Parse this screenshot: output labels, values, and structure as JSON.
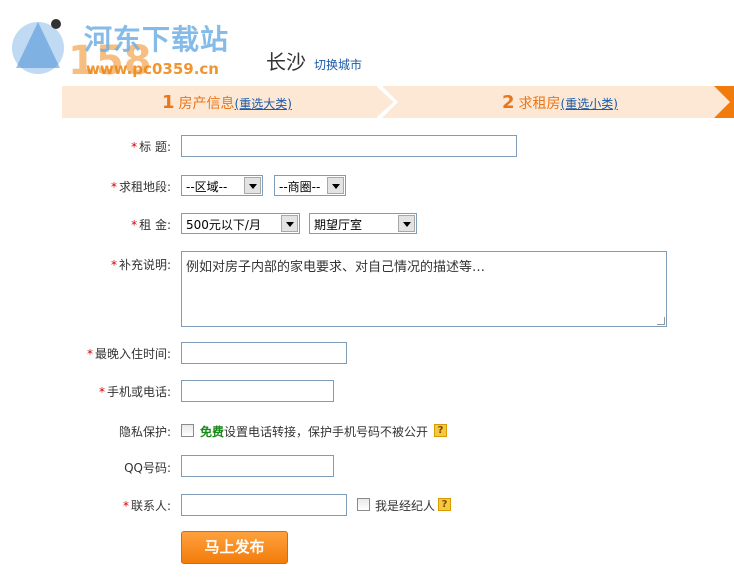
{
  "header": {
    "logo_text": "河东下载站",
    "logo_number": "158",
    "logo_url": "www.pc0359.cn",
    "city": "长沙",
    "switch_city": "切换城市"
  },
  "steps": [
    {
      "num": "1",
      "label": "房产信息",
      "sub": "(重选大类)"
    },
    {
      "num": "2",
      "label": "求租房",
      "sub": "(重选小类)"
    }
  ],
  "form": {
    "title": {
      "label": "标 题:",
      "required": true,
      "value": ""
    },
    "area": {
      "label": "求租地段:",
      "required": true,
      "district": "--区域--",
      "zone": "--商圈--"
    },
    "rent": {
      "label": "租 金:",
      "required": true,
      "price": "500元以下/月",
      "layout": "期望厅室"
    },
    "note": {
      "label": "补充说明:",
      "required": true,
      "placeholder": "例如对房子内部的家电要求、对自己情况的描述等…"
    },
    "latest_move_in": {
      "label": "最晚入住时间:",
      "required": true,
      "value": ""
    },
    "phone": {
      "label": "手机或电话:",
      "required": true,
      "value": ""
    },
    "privacy": {
      "label": "隐私保护:",
      "required": false,
      "free": "免费",
      "text": "设置电话转接，保护手机号码不被公开"
    },
    "qq": {
      "label": "QQ号码:",
      "required": false,
      "value": ""
    },
    "contact": {
      "label": "联系人:",
      "required": true,
      "value": "",
      "agent_label": "我是经纪人"
    },
    "required_mark": "*",
    "help_icon": "?",
    "submit_label": "马上发布"
  },
  "colors": {
    "accent": "#f27c0b",
    "steps_bg": "#fde8d6",
    "link": "#1a5aa8",
    "required": "#d40000"
  }
}
